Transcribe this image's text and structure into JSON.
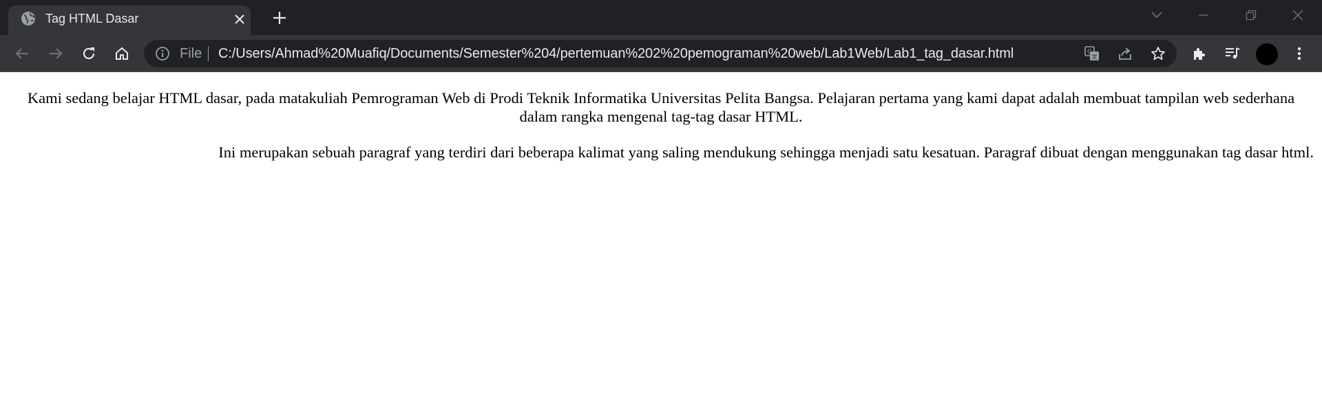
{
  "tab": {
    "title": "Tag HTML Dasar",
    "favicon": "globe-icon"
  },
  "toolbar": {
    "icons": [
      "back-arrow-icon",
      "forward-arrow-icon",
      "reload-icon",
      "home-icon"
    ]
  },
  "omnibox": {
    "scheme_label": "File",
    "url": "C:/Users/Ahmad%20Muafiq/Documents/Semester%204/pertemuan%202%20pemograman%20web/Lab1Web/Lab1_tag_dasar.html",
    "icons": [
      "translate-icon",
      "share-icon",
      "bookmark-star-icon"
    ]
  },
  "extensions": {
    "icons": [
      "extensions-puzzle-icon",
      "media-control-icon",
      "profile-avatar",
      "menu-kebab-icon"
    ]
  },
  "window_controls": [
    "tab-search-icon",
    "minimize-icon",
    "restore-icon",
    "close-window-icon"
  ],
  "colors": {
    "frame": "#202124",
    "toolbar": "#35363a",
    "omnibox": "#202124",
    "text_light": "#e8eaed",
    "icon": "#9aa0a6"
  },
  "content": {
    "paragraph_1": "Kami sedang belajar HTML dasar, pada matakuliah Pemrograman Web di Prodi Teknik Informatika Universitas Pelita Bangsa. Pelajaran pertama yang kami dapat adalah membuat tampilan web sederhana dalam rangka mengenal tag-tag dasar HTML.",
    "paragraph_2": "Ini merupakan sebuah paragraf yang terdiri dari beberapa kalimat yang saling mendukung sehingga menjadi satu kesatuan. Paragraf dibuat dengan menggunakan tag dasar html."
  }
}
